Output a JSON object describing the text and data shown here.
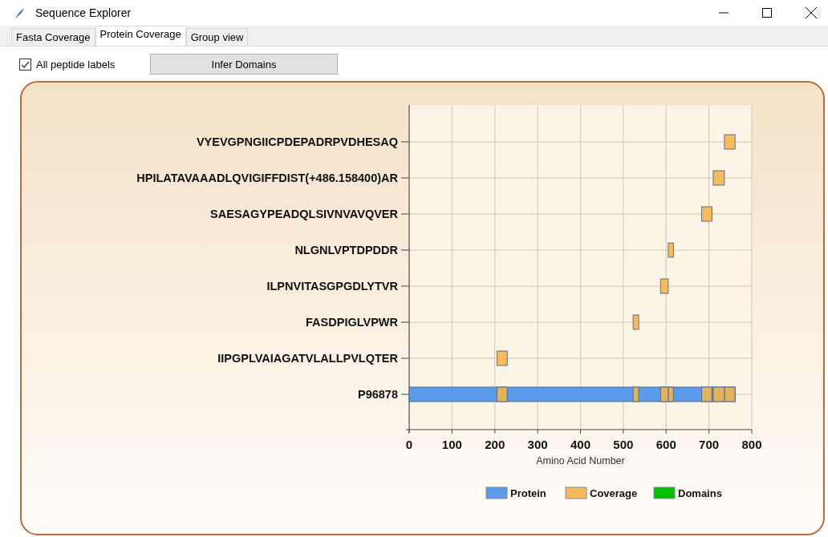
{
  "window": {
    "title": "Sequence Explorer"
  },
  "tabs": [
    {
      "label": "Fasta Coverage",
      "selected": false
    },
    {
      "label": "Protein Coverage",
      "selected": true
    },
    {
      "label": "Group view",
      "selected": false
    }
  ],
  "toolbar": {
    "checkbox": {
      "label": "All peptide labels",
      "checked": true
    },
    "button": "Infer Domains"
  },
  "chart": {
    "chart_data": {
      "type": "bar",
      "orientation": "horizontal",
      "xlabel": "Amino Acid Number",
      "grid": true,
      "legend": "bottom",
      "xlim": [
        0,
        800
      ],
      "xticks": [
        0,
        100,
        200,
        300,
        400,
        500,
        600,
        700,
        800
      ],
      "categories": [
        "VYEVGPNGIICPDEPADRPVDHESAQ",
        "HPILATAVAAADLQVIGIFFDIST(+486.158400)AR",
        "SAESAGYPEADQLSIVNVAVQVER",
        "NLGNLVPTDPDDR",
        "ILPNVITASGPGDLYTVR",
        "FASDPIGLVPWR",
        "IIPGPLVAIAGATVLALLPVLQTER",
        "P96878"
      ],
      "series": [
        {
          "name": "Protein",
          "color": "#5b9bea",
          "base": [
            null,
            null,
            null,
            null,
            null,
            null,
            null,
            0
          ],
          "values": [
            null,
            null,
            null,
            null,
            null,
            null,
            null,
            761
          ]
        },
        {
          "name": "Coverage",
          "color": "#f9bb5a",
          "base": [
            736,
            710,
            683,
            605,
            587,
            523,
            205,
            null
          ],
          "values": [
            25,
            26,
            24,
            12,
            18,
            13,
            24,
            null
          ]
        },
        {
          "name": "Domains",
          "color": "#00c000",
          "values": [
            null,
            null,
            null,
            null,
            null,
            null,
            null,
            null
          ]
        }
      ]
    }
  }
}
